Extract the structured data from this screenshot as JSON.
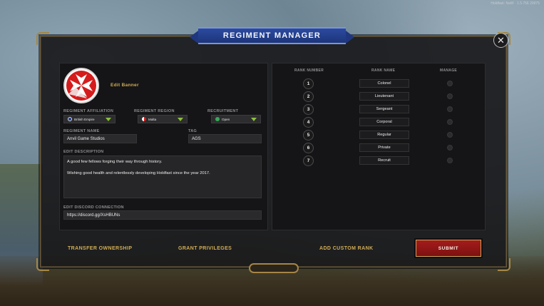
{
  "window": {
    "title": "REGIMENT MANAGER",
    "close_icon": "close-icon"
  },
  "overlay": {
    "version": "Holdfast: NaW · 1.5.756 29975"
  },
  "banner": {
    "edit_label": "Edit Banner",
    "emblem_icon": "maltese-cross-icon"
  },
  "fields": {
    "affiliation": {
      "label": "REGIMENT AFFILIATION",
      "value": "British Empire",
      "flag_color": "#1f3e8a"
    },
    "region": {
      "label": "REGIMENT REGION",
      "value": "Malta",
      "flag_color": "#d71b1b"
    },
    "recruitment": {
      "label": "RECRUITMENT",
      "value": "Open",
      "status_color": "#3aa85b"
    },
    "name": {
      "label": "REGIMENT NAME",
      "value": "Anvil Game Studios"
    },
    "tag": {
      "label": "TAG",
      "value": "AGS"
    },
    "description": {
      "label": "EDIT DESCRIPTION",
      "line1": "A good few fellows forging their way through history.",
      "line2": "Wishing good health and relentlessly developing Holdfast since the year 2017."
    },
    "discord": {
      "label": "EDIT DISCORD CONNECTION",
      "value": "https://discord.gg/XsHBUNs"
    }
  },
  "ranks": {
    "headers": {
      "number": "RANK NUMBER",
      "name": "RANK NAME",
      "manage": "MANAGE"
    },
    "rows": [
      {
        "number": "1",
        "name": "Colonel"
      },
      {
        "number": "2",
        "name": "Lieutenant"
      },
      {
        "number": "3",
        "name": "Sergeant"
      },
      {
        "number": "4",
        "name": "Corporal"
      },
      {
        "number": "5",
        "name": "Regular"
      },
      {
        "number": "6",
        "name": "Private"
      },
      {
        "number": "7",
        "name": "Recruit"
      }
    ]
  },
  "actions": {
    "transfer": "TRANSFER OWNERSHIP",
    "grant": "GRANT PRIVILEGES",
    "add_rank": "ADD CUSTOM RANK",
    "submit": "SUBMIT"
  },
  "colors": {
    "accent_gold": "#d1ad54",
    "banner_blue": "#2b4aa0",
    "submit_red": "#a41c1c"
  }
}
